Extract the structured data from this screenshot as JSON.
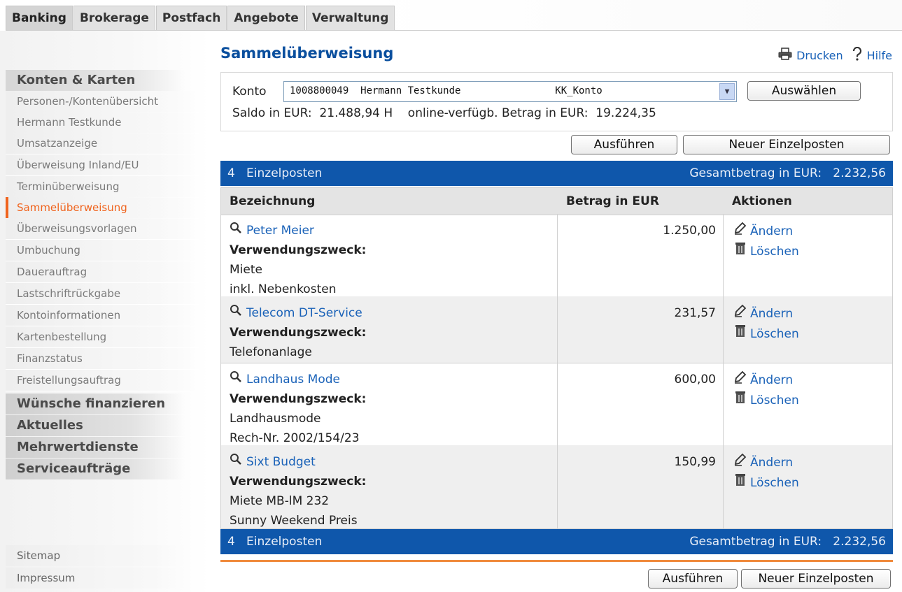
{
  "tabs": [
    "Banking",
    "Brokerage",
    "Postfach",
    "Angebote",
    "Verwaltung"
  ],
  "sidebar": {
    "section_title": "Konten & Karten",
    "items": [
      "Personen-/Kontenübersicht",
      "Hermann Testkunde",
      "Umsatzanzeige",
      "Überweisung Inland/EU",
      "Terminüberweisung",
      "Sammelüberweisung",
      "Überweisungsvorlagen",
      "Umbuchung",
      "Dauerauftrag",
      "Lastschriftrückgabe",
      "Kontoinformationen",
      "Kartenbestellung",
      "Finanzstatus",
      "Freistellungsauftrag"
    ],
    "active_item": "Sammelüberweisung",
    "sections": [
      "Wünsche finanzieren",
      "Aktuelles",
      "Mehrwertdienste",
      "Serviceaufträge"
    ],
    "footer": [
      "Sitemap",
      "Impressum"
    ]
  },
  "page": {
    "title": "Sammelüberweisung",
    "print_label": "Drucken",
    "help_label": "Hilfe"
  },
  "konto": {
    "label": "Konto",
    "selected": "1008800049  Hermann Testkunde                KK_Konto",
    "select_button": "Auswählen",
    "saldo_label": "Saldo in EUR:",
    "saldo_value": "21.488,94 H",
    "available_label": "online-verfügb. Betrag in EUR:",
    "available_value": "19.224,35"
  },
  "buttons": {
    "execute": "Ausführen",
    "new_item": "Neuer Einzelposten"
  },
  "summary": {
    "count": "4",
    "count_label": "Einzelposten",
    "total_label": "Gesamtbetrag in EUR:",
    "total_value": "2.232,56"
  },
  "table": {
    "headers": [
      "Bezeichnung",
      "Betrag in EUR",
      "Aktionen"
    ],
    "purpose_label": "Verwendungszweck:",
    "edit_label": "Ändern",
    "delete_label": "Löschen",
    "rows": [
      {
        "name": "Peter Meier",
        "amount": "1.250,00",
        "purpose": [
          "Miete",
          "inkl. Nebenkosten"
        ]
      },
      {
        "name": "Telecom DT-Service",
        "amount": "231,57",
        "purpose": [
          "Telefonanlage"
        ]
      },
      {
        "name": "Landhaus Mode",
        "amount": "600,00",
        "purpose": [
          "Landhausmode",
          "Rech-Nr. 2002/154/23"
        ]
      },
      {
        "name": "Sixt Budget",
        "amount": "150,99",
        "purpose": [
          "Miete MB-lM 232",
          "Sunny Weekend Preis"
        ]
      }
    ]
  }
}
